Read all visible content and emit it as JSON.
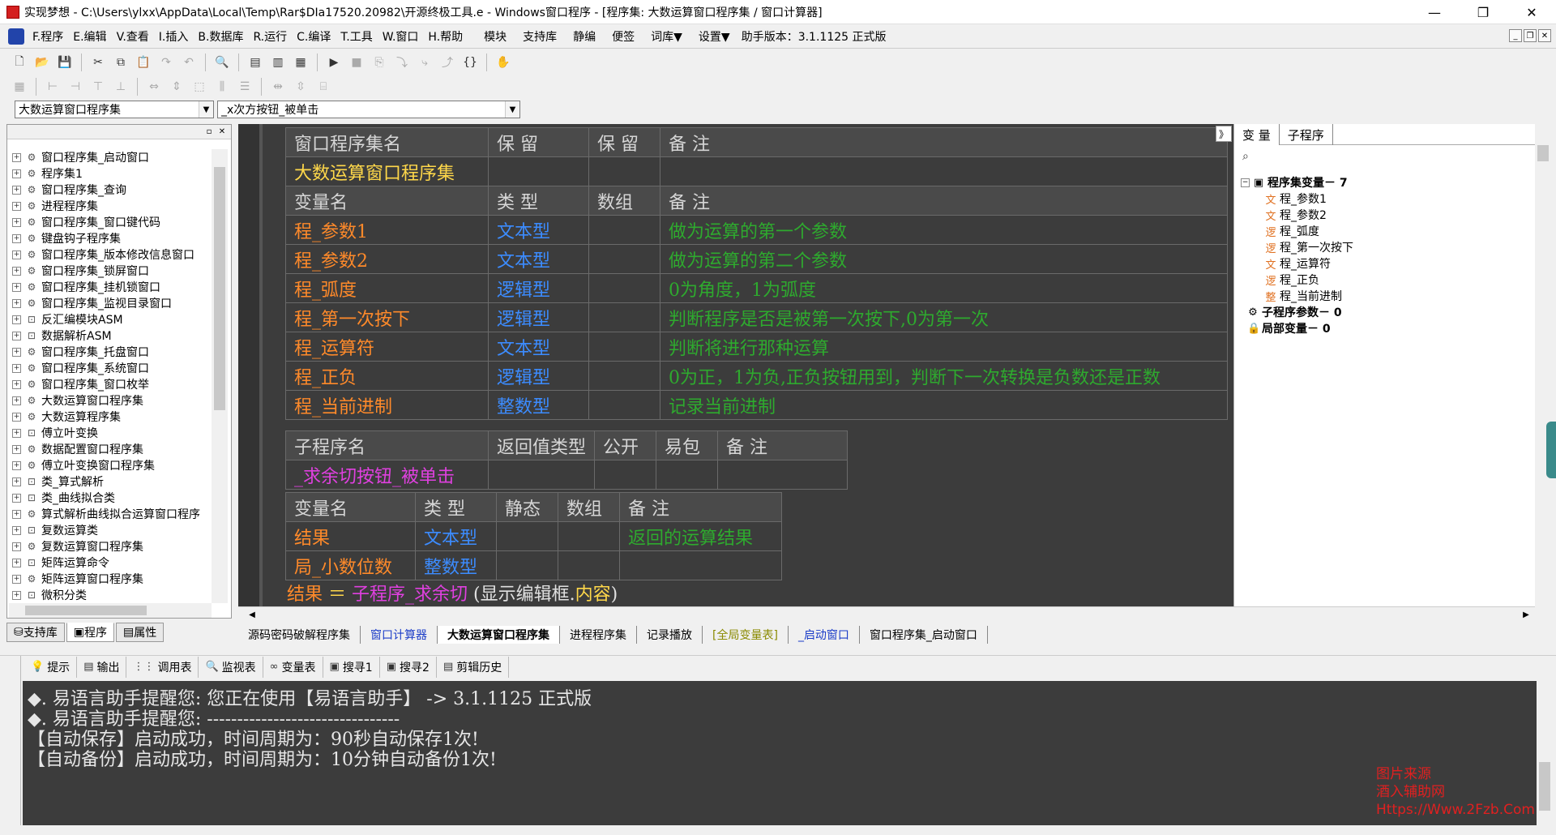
{
  "window": {
    "title": "实现梦想 - C:\\Users\\ylxx\\AppData\\Local\\Temp\\Rar$DIa17520.20982\\开源终极工具.e - Windows窗口程序 - [程序集: 大数运算窗口程序集 / 窗口计算器]",
    "minimize": "—",
    "restore": "❐",
    "close": "✕"
  },
  "menu": {
    "items": [
      "F.程序",
      "E.编辑",
      "V.查看",
      "I.插入",
      "B.数据库",
      "R.运行",
      "C.编译",
      "T.工具",
      "W.窗口",
      "H.帮助",
      "模块",
      "支持库",
      "静编",
      "便签",
      "词库▼",
      "设置▼"
    ],
    "helper_version": "助手版本：3.1.1125 正式版"
  },
  "selectors": {
    "assembly": "大数运算窗口程序集",
    "subroutine": "_x次方按钮_被单击"
  },
  "tree": {
    "items": [
      "窗口程序集_启动窗口",
      "程序集1",
      "窗口程序集_查询",
      "进程程序集",
      "窗口程序集_窗口键代码",
      "键盘钩子程序集",
      "窗口程序集_版本修改信息窗口",
      "窗口程序集_锁屏窗口",
      "窗口程序集_挂机锁窗口",
      "窗口程序集_监视目录窗口",
      "反汇编模块ASM",
      "数据解析ASM",
      "窗口程序集_托盘窗口",
      "窗口程序集_系统窗口",
      "窗口程序集_窗口枚举",
      "大数运算窗口程序集",
      "大数运算程序集",
      "傅立叶变换",
      "数据配置窗口程序集",
      "傅立叶变换窗口程序集",
      "类_算式解析",
      "类_曲线拟合类",
      "算式解析曲线拟合运算窗口程序",
      "复数运算类",
      "复数运算窗口程序集",
      "矩阵运算命令",
      "矩阵运算窗口程序集",
      "微积分类"
    ],
    "icons": [
      "gear",
      "gear",
      "gear",
      "gear",
      "gear",
      "gear",
      "gear",
      "gear",
      "gear",
      "gear",
      "module",
      "module",
      "gear",
      "gear",
      "gear",
      "gear",
      "gear",
      "module",
      "gear",
      "gear",
      "module",
      "module",
      "gear",
      "module",
      "gear",
      "module",
      "gear",
      "module"
    ]
  },
  "left_tabs": [
    "支持库",
    "程序",
    "属性"
  ],
  "assembly_table": {
    "headers": [
      "窗口程序集名",
      "保 留",
      "保 留",
      "备 注"
    ],
    "row": [
      "大数运算窗口程序集",
      "",
      "",
      ""
    ]
  },
  "var_table": {
    "headers": [
      "变量名",
      "类 型",
      "数组",
      "备 注"
    ],
    "rows": [
      {
        "name": "程_参数1",
        "type": "文本型",
        "arr": "",
        "note": "做为运算的第一个参数"
      },
      {
        "name": "程_参数2",
        "type": "文本型",
        "arr": "",
        "note": "做为运算的第二个参数"
      },
      {
        "name": "程_弧度",
        "type": "逻辑型",
        "arr": "",
        "note": "0为角度，1为弧度"
      },
      {
        "name": "程_第一次按下",
        "type": "逻辑型",
        "arr": "",
        "note": "判断程序是否是被第一次按下,0为第一次"
      },
      {
        "name": "程_运算符",
        "type": "文本型",
        "arr": "",
        "note": "判断将进行那种运算"
      },
      {
        "name": "程_正负",
        "type": "逻辑型",
        "arr": "",
        "note": "0为正，1为负,正负按钮用到，判断下一次转换是负数还是正数"
      },
      {
        "name": "程_当前进制",
        "type": "整数型",
        "arr": "",
        "note": "记录当前进制"
      }
    ]
  },
  "sub_table": {
    "headers": [
      "子程序名",
      "返回值类型",
      "公开",
      "易包",
      "备 注"
    ],
    "row": [
      "_求余切按钮_被单击",
      "",
      "",
      "",
      ""
    ]
  },
  "local_table": {
    "headers": [
      "变量名",
      "类 型",
      "静态",
      "数组",
      "备 注"
    ],
    "rows": [
      {
        "name": "结果",
        "type": "文本型",
        "static": "",
        "arr": "",
        "note": "返回的运算结果"
      },
      {
        "name": "局_小数位数",
        "type": "整数型",
        "static": "",
        "arr": "",
        "note": ""
      }
    ]
  },
  "code": {
    "lhs": "结果",
    "op": " ＝ ",
    "func": "子程序_求余切",
    "paren_open": " (显示编辑框.",
    "prop": "内容",
    "paren_close": ")"
  },
  "right_panel": {
    "tabs": [
      "变 量",
      "子程序"
    ],
    "collapse": "》",
    "assembly_vars_label": "程序集变量",
    "assembly_vars_count": " － 7",
    "vars": [
      {
        "badge": "文",
        "name": "程_参数1"
      },
      {
        "badge": "文",
        "name": "程_参数2"
      },
      {
        "badge": "逻",
        "name": "程_弧度"
      },
      {
        "badge": "逻",
        "name": "程_第一次按下"
      },
      {
        "badge": "文",
        "name": "程_运算符"
      },
      {
        "badge": "逻",
        "name": "程_正负"
      },
      {
        "badge": "整",
        "name": "程_当前进制"
      }
    ],
    "sub_params_label": "子程序参数",
    "sub_params_count": " － 0",
    "local_vars_label": "局部变量",
    "local_vars_count": " － 0"
  },
  "doc_tabs": [
    {
      "label": "源码密码破解程序集",
      "style": ""
    },
    {
      "label": "窗口计算器",
      "style": "blue"
    },
    {
      "label": "大数运算窗口程序集",
      "style": "active"
    },
    {
      "label": "进程程序集",
      "style": ""
    },
    {
      "label": "记录播放",
      "style": ""
    },
    {
      "label": "[全局变量表]",
      "style": "olive"
    },
    {
      "label": "_启动窗口",
      "style": "blue"
    },
    {
      "label": "窗口程序集_启动窗口",
      "style": ""
    }
  ],
  "output_tabs": [
    "提示",
    "输出",
    "调用表",
    "监视表",
    "变量表",
    "搜寻1",
    "搜寻2",
    "剪辑历史"
  ],
  "output_lines": [
    "◆. 易语言助手提醒您: 您正在使用【易语言助手】 ->  3.1.1125 正式版",
    "◆. 易语言助手提醒您: --------------------------------",
    "【自动保存】启动成功，时间周期为：90秒自动保存1次!",
    "【自动备份】启动成功，时间周期为：10分钟自动备份1次!"
  ],
  "watermark": [
    "图片来源",
    "酒入辅助网",
    "Https://Www.2Fzb.Com"
  ],
  "colors": {
    "editor_bg": "#3c3c3c",
    "var_name": "#ff8a2a",
    "type": "#3c8cff",
    "comment": "#2eaa2e",
    "sub_name": "#e040e0",
    "assembly_name": "#ffd84a"
  }
}
